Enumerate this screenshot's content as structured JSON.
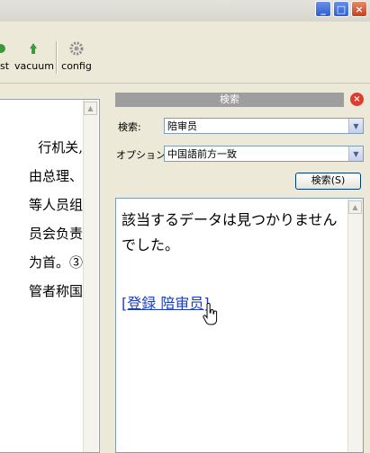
{
  "toolbar": {
    "buttons": [
      {
        "label": "st",
        "icon": "cleanup-icon"
      },
      {
        "label": "vacuum",
        "icon": "vacuum-icon"
      },
      {
        "label": "config",
        "icon": "gear-icon"
      }
    ]
  },
  "document": {
    "lines": [
      "行机关,",
      "由总理、",
      "等人员组",
      "员会负责",
      "为首。③",
      "管者称国"
    ]
  },
  "search_panel": {
    "title": "検索",
    "query_label": "検索:",
    "query_value": "陪审员",
    "option_label": "オプション:",
    "option_value": "中国語前方一致",
    "search_button": "検索(S)",
    "result_message": "該当するデータは見つかりませんでした。",
    "result_link": "[登録 陪审员]"
  }
}
